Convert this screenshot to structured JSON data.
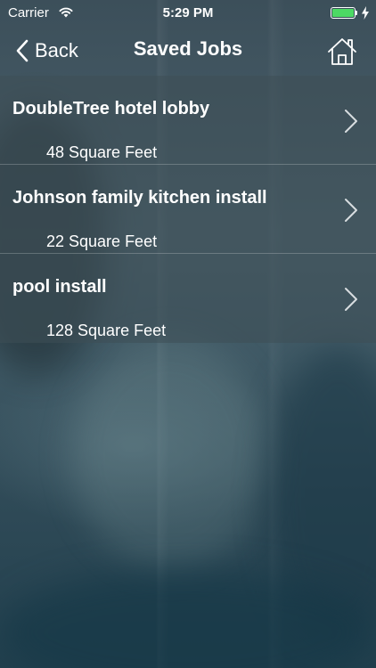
{
  "status_bar": {
    "carrier": "Carrier",
    "time": "5:29 PM",
    "battery_color": "#4cd964",
    "icons": [
      "wifi-icon",
      "battery-icon",
      "charging-icon"
    ]
  },
  "nav_bar": {
    "back_label": "Back",
    "title": "Saved Jobs",
    "icons": [
      "chevron-left-icon",
      "home-icon"
    ]
  },
  "jobs": [
    {
      "name": "DoubleTree hotel lobby",
      "area": "48 Square Feet"
    },
    {
      "name": "Johnson family kitchen install",
      "area": "22 Square Feet"
    },
    {
      "name": "pool install",
      "area": "128 Square Feet"
    }
  ],
  "row_icon": "chevron-right-icon"
}
